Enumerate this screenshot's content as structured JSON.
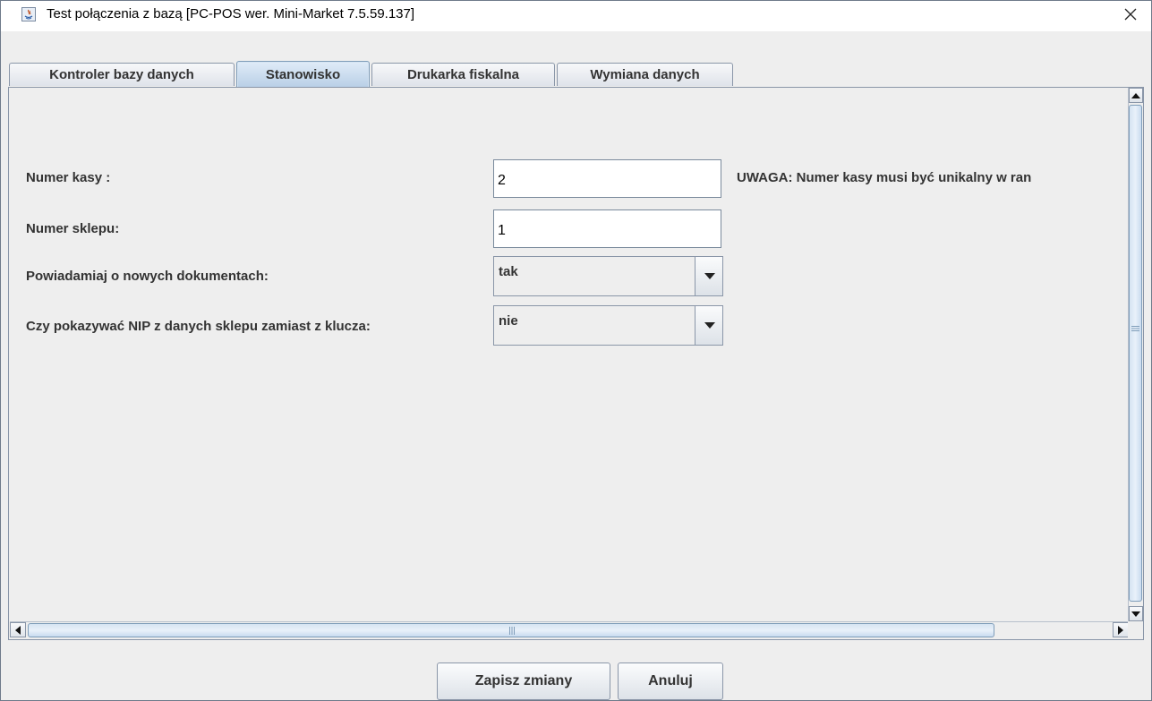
{
  "window": {
    "title": "Test połączenia z bazą [PC-POS wer. Mini-Market 7.5.59.137]",
    "close_glyph": "✕",
    "icon": "java-icon"
  },
  "tabs": [
    {
      "label": "Kontroler bazy danych",
      "active": false
    },
    {
      "label": "Stanowisko",
      "active": true
    },
    {
      "label": "Drukarka fiskalna",
      "active": false
    },
    {
      "label": "Wymiana danych",
      "active": false
    }
  ],
  "form": {
    "register_number": {
      "label": "Numer kasy :",
      "value": "2"
    },
    "store_number": {
      "label": "Numer sklepu:",
      "value": "1"
    },
    "notify_new_docs": {
      "label": "Powiadamiaj o nowych dokumentach:",
      "value": "tak"
    },
    "show_store_nip": {
      "label": "Czy pokazywać NIP z danych sklepu zamiast z klucza:",
      "value": "nie"
    },
    "note": "UWAGA: Numer kasy musi być unikalny w ran"
  },
  "buttons": {
    "save": "Zapisz zmiany",
    "cancel": "Anuluj"
  },
  "colors": {
    "active_tab": "#b8cfe6",
    "scroll_thumb": "#d6e4f2",
    "border": "#8a96a8"
  }
}
